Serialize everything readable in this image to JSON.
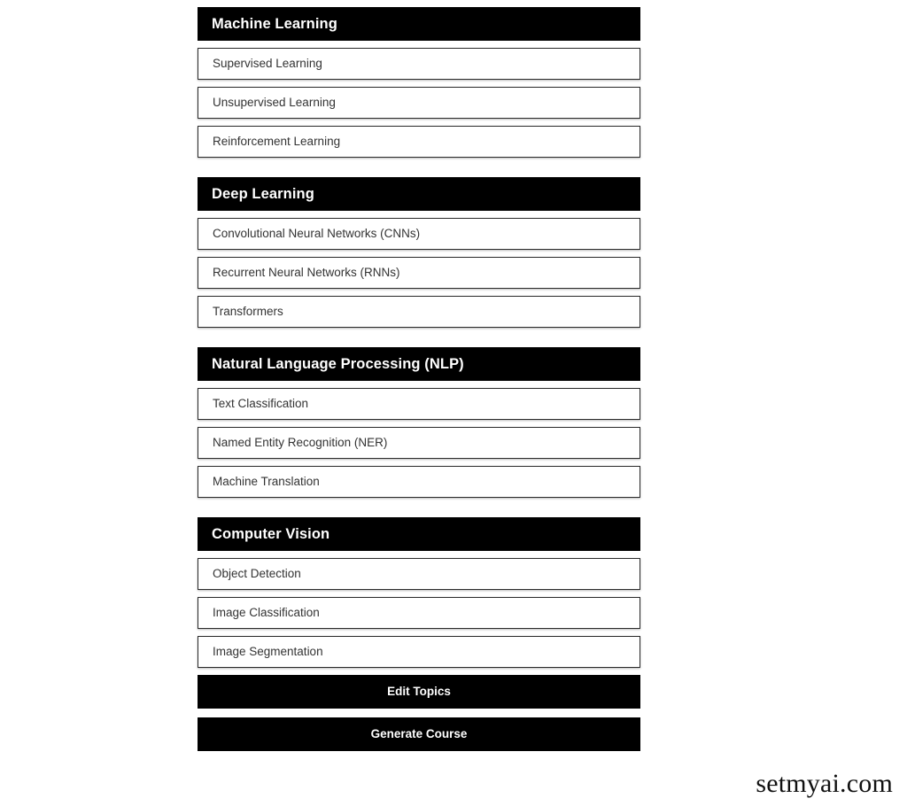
{
  "colors": {
    "header_bg": "#000000",
    "header_text": "#ffffff",
    "item_bg": "#ffffff",
    "item_border": "#2b2b2b",
    "item_text": "#333333",
    "button_bg": "#000000",
    "button_text": "#ffffff",
    "page_bg": "#ffffff"
  },
  "sections": [
    {
      "title": "Machine Learning",
      "topics": [
        "Supervised Learning",
        "Unsupervised Learning",
        "Reinforcement Learning"
      ]
    },
    {
      "title": "Deep Learning",
      "topics": [
        "Convolutional Neural Networks (CNNs)",
        "Recurrent Neural Networks (RNNs)",
        "Transformers"
      ]
    },
    {
      "title": "Natural Language Processing (NLP)",
      "topics": [
        "Text Classification",
        "Named Entity Recognition (NER)",
        "Machine Translation"
      ]
    },
    {
      "title": "Computer Vision",
      "topics": [
        "Object Detection",
        "Image Classification",
        "Image Segmentation"
      ]
    }
  ],
  "actions": {
    "edit_topics_label": "Edit Topics",
    "generate_course_label": "Generate Course"
  },
  "watermark": {
    "text": "setmyai.com"
  }
}
